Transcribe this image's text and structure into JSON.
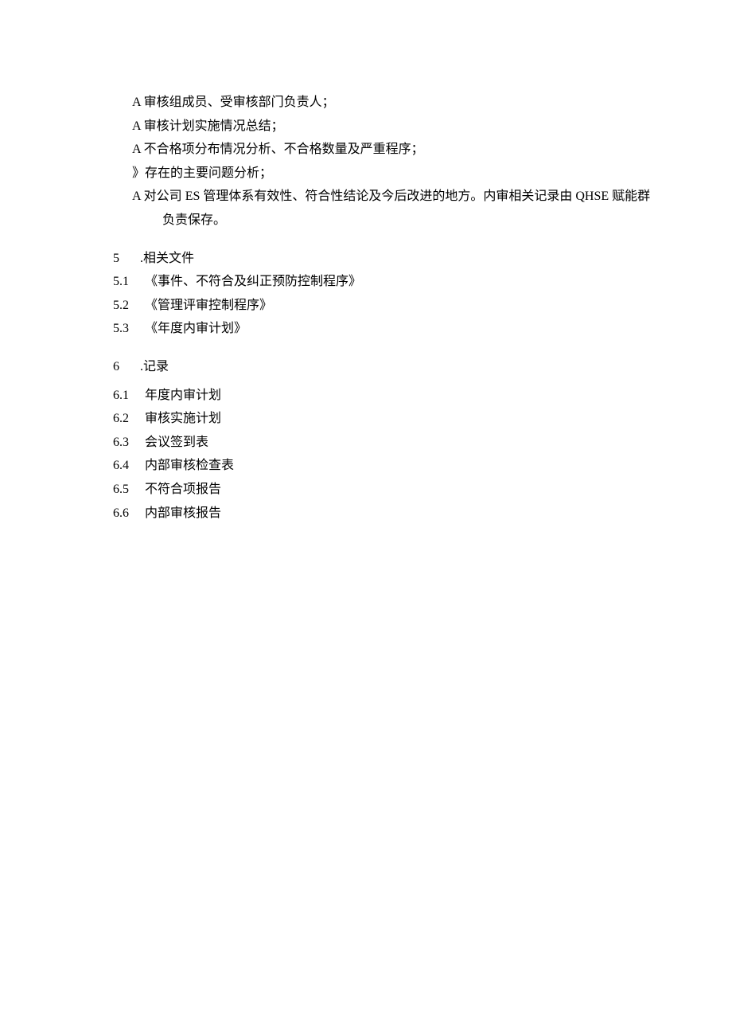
{
  "bullets": {
    "b1_prefix": "A ",
    "b1": "审核组成员、受审核部门负责人；",
    "b2_prefix": "A ",
    "b2": "审核计划实施情况总结；",
    "b3_prefix": "A ",
    "b3": "不合格项分布情况分析、不合格数量及严重程序；",
    "b4_prefix": "》",
    "b4": "存在的主要问题分析；",
    "b5_prefix": "A ",
    "b5_part1": "对公司 ",
    "b5_es": "ES ",
    "b5_part2": "管理体系有效性、符合性结论及今后改进的地方。内审相关记录由 ",
    "b5_qhse": "QHSE ",
    "b5_part3": "赋能群负责保存。"
  },
  "section5": {
    "num": "5",
    "dot": " .",
    "title": "相关文件",
    "items": [
      {
        "num": "5.1",
        "text": "《事件、不符合及纠正预防控制程序》"
      },
      {
        "num": "5.2",
        "text": "《管理评审控制程序》"
      },
      {
        "num": "5.3",
        "text": "《年度内审计划》"
      }
    ]
  },
  "section6": {
    "num": "6",
    "dot": " .",
    "title": "记录",
    "items": [
      {
        "num": "6.1",
        "text": "年度内审计划"
      },
      {
        "num": "6.2",
        "text": "审核实施计划"
      },
      {
        "num": "6.3",
        "text": "会议签到表"
      },
      {
        "num": "6.4",
        "text": "内部审核检查表"
      },
      {
        "num": "6.5",
        "text": "不符合项报告"
      },
      {
        "num": "6.6",
        "text": "内部审核报告"
      }
    ]
  }
}
